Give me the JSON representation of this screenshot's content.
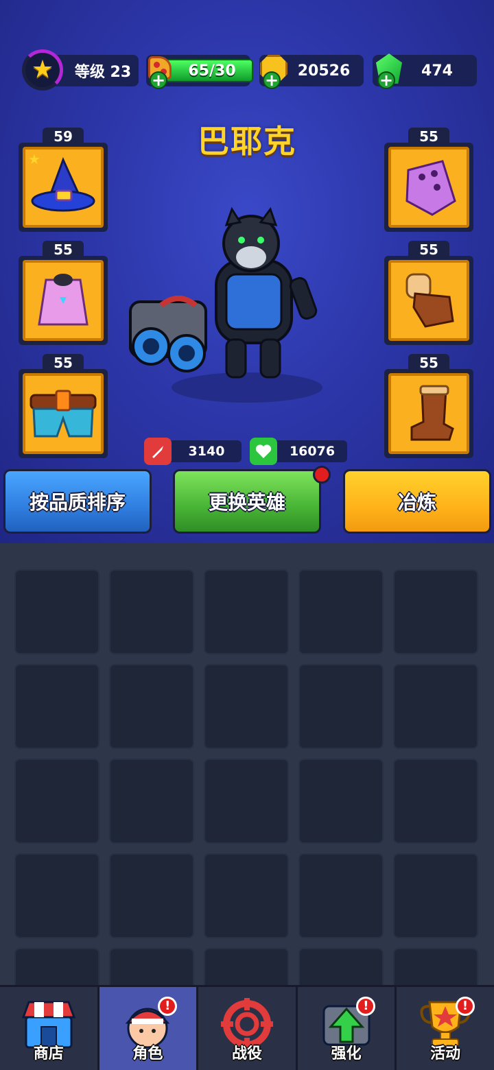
{
  "top_bar": {
    "level_label": "等级 23",
    "energy_value": "65/30",
    "gold_value": "20526",
    "gem_value": "474",
    "plus_glyph": "+",
    "level_progress_fraction": 0.35
  },
  "hero": {
    "name": "巴耶克"
  },
  "equipment": {
    "left": [
      {
        "level": "59",
        "item": "wizard-hat-icon"
      },
      {
        "level": "55",
        "item": "hooded-vest-icon"
      },
      {
        "level": "55",
        "item": "belt-pants-icon"
      }
    ],
    "right": [
      {
        "level": "55",
        "item": "purple-gem-armor-icon"
      },
      {
        "level": "55",
        "item": "brown-glove-icon"
      },
      {
        "level": "55",
        "item": "brown-boot-icon"
      }
    ]
  },
  "stats": {
    "attack": "3140",
    "health": "16076"
  },
  "buttons": {
    "sort": "按品质排序",
    "switch_hero": "更换英雄",
    "smelt": "冶炼"
  },
  "bottom_nav": [
    {
      "label": "商店",
      "icon": "shop-icon",
      "badge": false
    },
    {
      "label": "角色",
      "icon": "character-icon",
      "badge": true,
      "active": true
    },
    {
      "label": "战役",
      "icon": "campaign-target-icon",
      "badge": false
    },
    {
      "label": "强化",
      "icon": "upgrade-arrow-icon",
      "badge": true
    },
    {
      "label": "活动",
      "icon": "trophy-icon",
      "badge": true
    }
  ],
  "badge_glyph": "!",
  "colors": {
    "accent_yellow": "#ffd42a",
    "slot_orange": "#fbb01f",
    "sort_blue": "#2f7ee0",
    "switch_green": "#48b435",
    "smelt_orange": "#ffb21a",
    "badge_red": "#e21d1d"
  }
}
